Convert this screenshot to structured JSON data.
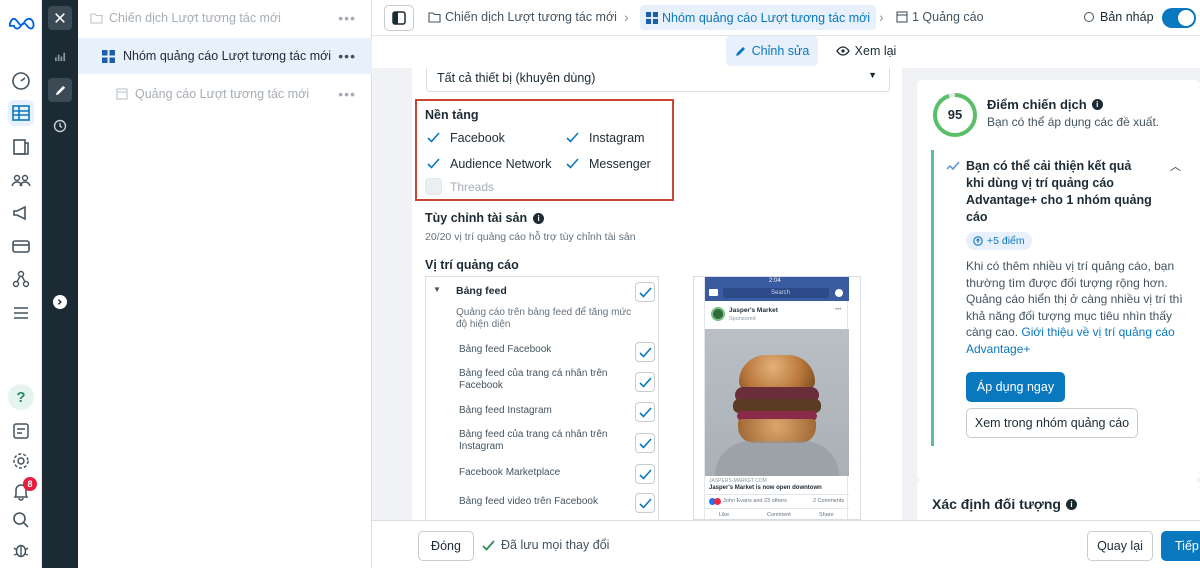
{
  "sidebar": {
    "notif_count": "8"
  },
  "tree": {
    "campaign": "Chiến dịch Lượt tương tác mới",
    "adset": "Nhóm quảng cáo Lượt tương tác mới",
    "ad": "Quảng cáo Lượt tương tác mới"
  },
  "topbar": {
    "crumb_campaign": "Chiến dịch Lượt tương tác mới",
    "crumb_adset": "Nhóm quảng cáo Lượt tương tác mới",
    "crumb_ad": "1 Quảng cáo",
    "status": "Bản nháp",
    "edit": "Chỉnh sửa",
    "review": "Xem lại"
  },
  "form": {
    "devices": "Tất cả thiết bị (khuyên dùng)",
    "platforms_title": "Nền tảng",
    "platforms": [
      {
        "label": "Facebook",
        "checked": true
      },
      {
        "label": "Instagram",
        "checked": true
      },
      {
        "label": "Audience Network",
        "checked": true
      },
      {
        "label": "Messenger",
        "checked": true
      },
      {
        "label": "Threads",
        "checked": false
      }
    ],
    "asset_title": "Tùy chỉnh tài sản",
    "asset_desc": "20/20 vị trí quảng cáo hỗ trợ tùy chỉnh tài sản",
    "placements_title": "Vị trí quảng cáo",
    "feeds_group": "Bảng feed",
    "feeds_desc": "Quảng cáo trên bảng feed để tăng mức độ hiện diện",
    "placements": [
      "Bảng feed Facebook",
      "Bảng feed của trang cá nhân trên Facebook",
      "Bảng feed Instagram",
      "Bảng feed của trang cá nhân trên Instagram",
      "Facebook Marketplace",
      "Bảng feed video trên Facebook"
    ]
  },
  "preview": {
    "time": "2:04",
    "search": "Search",
    "page": "Jasper's Market",
    "sponsored": "Sponsored",
    "domain": "JASPERS-MARKET.COM",
    "headline": "Jasper's Market is now open downtown",
    "reactors": "John Evans and 23 others",
    "comments": "2 Comments",
    "like": "Like",
    "comment": "Comment",
    "share": "Share"
  },
  "score": {
    "value": "95",
    "title": "Điểm chiến dịch",
    "subtitle": "Bạn có thể áp dụng các đề xuất.",
    "rec_title": "Bạn có thể cải thiện kết quả khi dùng vị trí quảng cáo Advantage+ cho 1 nhóm quảng cáo",
    "points": "+5 điểm",
    "body": "Khi có thêm nhiều vị trí quảng cáo, bạn thường tìm được đối tượng rộng hơn. Quảng cáo hiển thị ở càng nhiều vị trí thì khả năng đối tượng mục tiêu nhìn thấy càng cao.",
    "link": "Giới thiệu về vị trí quảng cáo Advantage+",
    "apply": "Áp dụng ngay",
    "view": "Xem trong nhóm quảng cáo",
    "audience_title": "Xác định đối tượng"
  },
  "bottom": {
    "close": "Đóng",
    "saved": "Đã lưu mọi thay đổi",
    "back": "Quay lại",
    "next": "Tiếp"
  },
  "colors": {
    "accent": "#0a78be",
    "brand": "#0064e0",
    "highlight": "#c9472f",
    "dark": "#1c2b33"
  }
}
